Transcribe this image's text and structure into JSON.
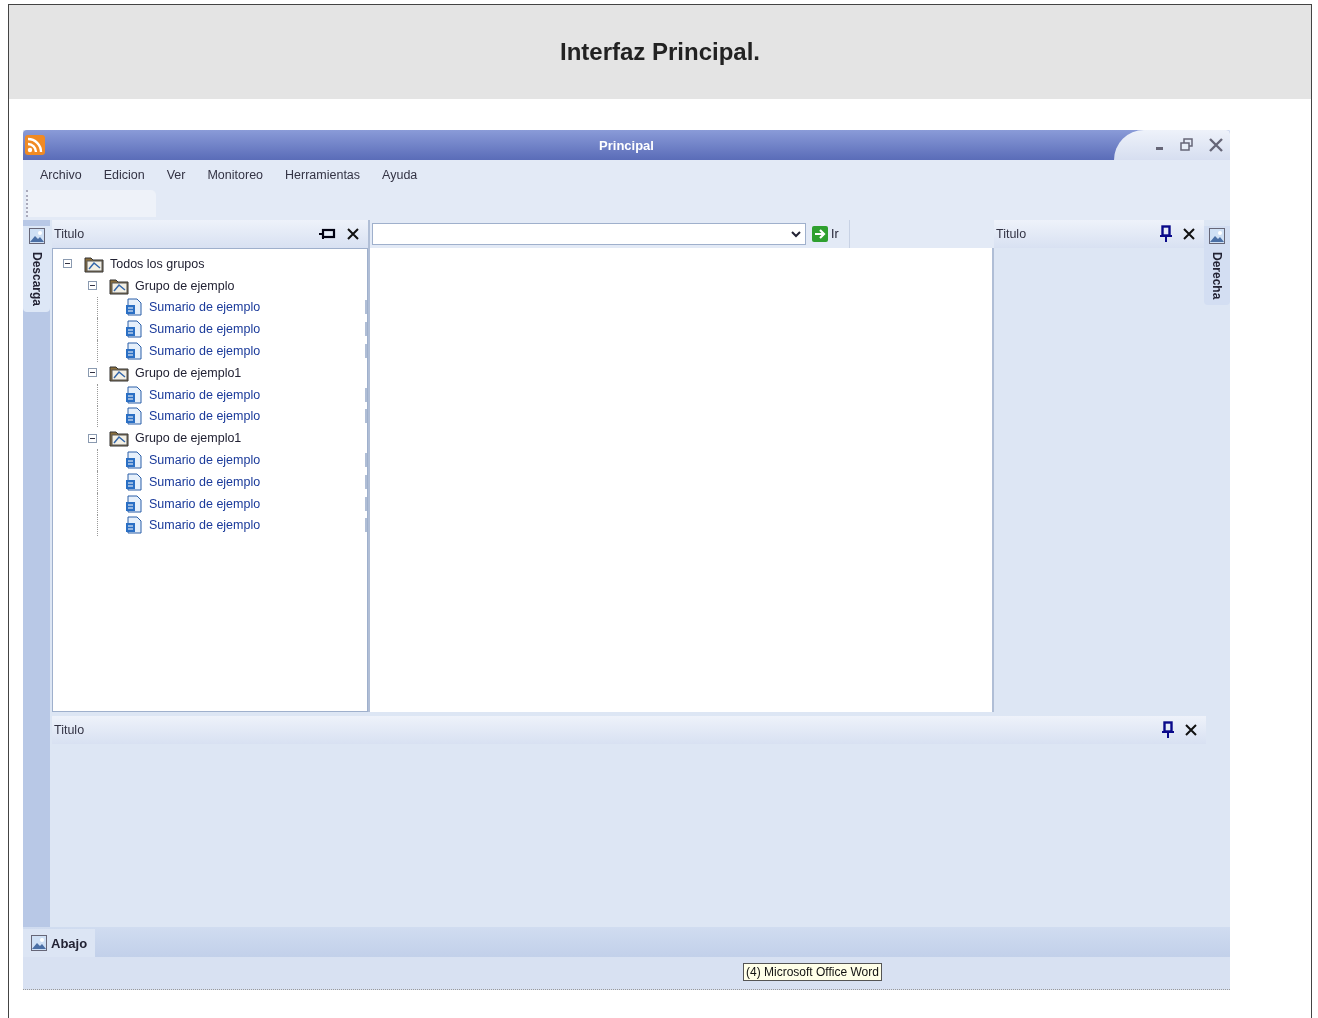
{
  "page_title": "Interfaz Principal.",
  "window": {
    "title": "Principal"
  },
  "menu": [
    "Archivo",
    "Edicion",
    "Ver",
    "Monitoreo",
    "Herramientas",
    "Ayuda"
  ],
  "left_tab": {
    "label": "Descarga"
  },
  "right_tab": {
    "label": "Derecha"
  },
  "left_panel": {
    "title": "Titulo",
    "tree": [
      {
        "label": "Todos los grupos",
        "kind": "root",
        "expanded": true,
        "children": [
          {
            "label": "Grupo de ejemplo",
            "kind": "group",
            "expanded": true,
            "children": [
              {
                "label": "Sumario de ejemplo",
                "kind": "doc"
              },
              {
                "label": "Sumario de ejemplo",
                "kind": "doc"
              },
              {
                "label": "Sumario de ejemplo",
                "kind": "doc"
              }
            ]
          },
          {
            "label": "Grupo de ejemplo1",
            "kind": "group",
            "expanded": true,
            "children": [
              {
                "label": "Sumario de ejemplo",
                "kind": "doc"
              },
              {
                "label": "Sumario de ejemplo",
                "kind": "doc"
              }
            ]
          },
          {
            "label": "Grupo de ejemplo1",
            "kind": "group",
            "expanded": true,
            "children": [
              {
                "label": "Sumario de ejemplo",
                "kind": "doc"
              },
              {
                "label": "Sumario de ejemplo",
                "kind": "doc"
              },
              {
                "label": "Sumario de ejemplo",
                "kind": "doc"
              },
              {
                "label": "Sumario de ejemplo",
                "kind": "doc"
              }
            ]
          }
        ]
      }
    ]
  },
  "address_bar": {
    "go_label": "Ir"
  },
  "right_panel": {
    "title": "Titulo"
  },
  "bottom_panel": {
    "title": "Titulo"
  },
  "bottom_tab": {
    "label": "Abajo"
  },
  "taskbar_tooltip": "(4) Microsoft Office Word"
}
